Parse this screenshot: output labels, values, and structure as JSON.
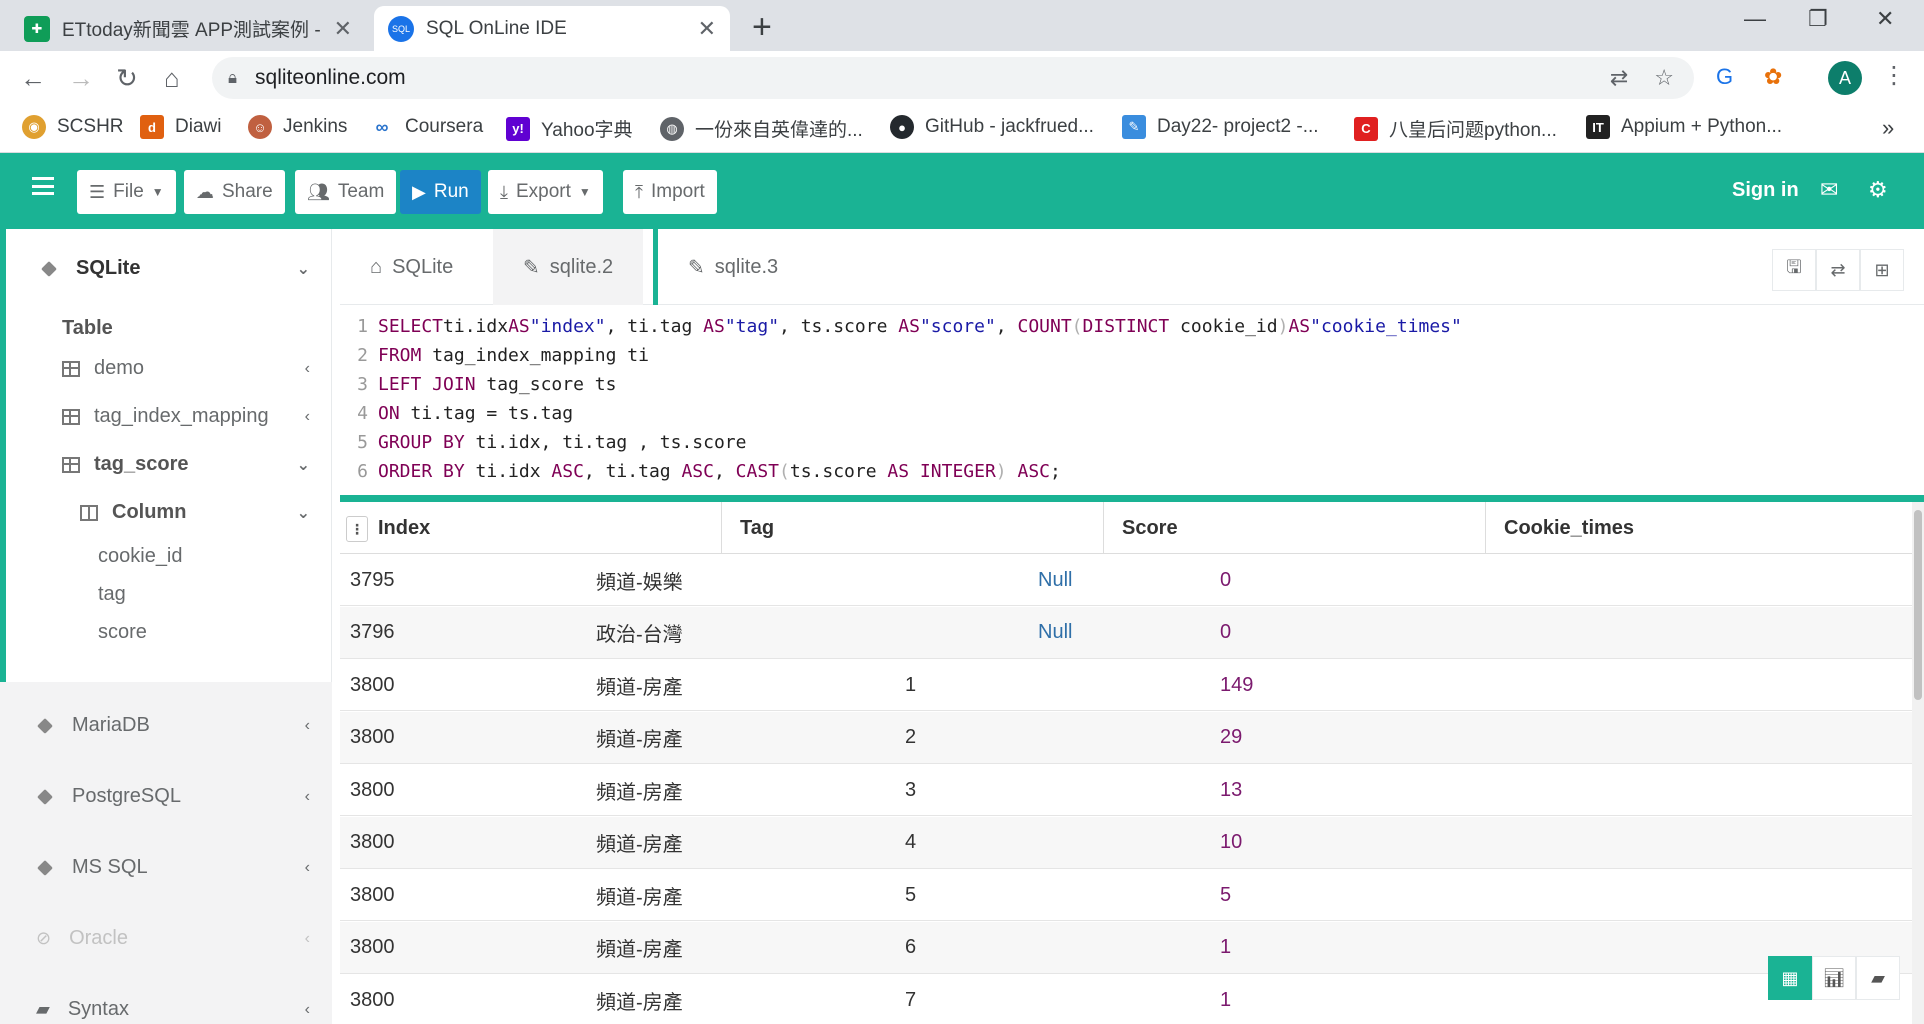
{
  "browser": {
    "tabs": [
      {
        "title": "ETtoday新聞雲 APP測試案例 - G",
        "icon": "sheets-icon",
        "active": false
      },
      {
        "title": "SQL OnLine IDE",
        "icon": "sql-icon",
        "active": true
      }
    ],
    "url": "sqliteonline.com",
    "profile_initial": "A",
    "bookmarks": [
      {
        "label": "SCSHR",
        "icon": "globe-icon",
        "color": "#e0a030"
      },
      {
        "label": "Diawi",
        "icon": "diawi-icon",
        "color": "#e06010"
      },
      {
        "label": "Jenkins",
        "icon": "jenkins-icon",
        "color": "#c06040"
      },
      {
        "label": "Coursera",
        "icon": "coursera-icon",
        "color": "#2a73cc"
      },
      {
        "label": "Yahoo字典",
        "icon": "yahoo-icon",
        "color": "#6001d2"
      },
      {
        "label": "一份來自英偉達的...",
        "icon": "globe-icon",
        "color": "#5f6368"
      },
      {
        "label": "GitHub - jackfrued...",
        "icon": "github-icon",
        "color": "#24292e"
      },
      {
        "label": "Day22- project2 -...",
        "icon": "ithome-icon",
        "color": "#3a8dde"
      },
      {
        "label": "八皇后问题python...",
        "icon": "csdn-icon",
        "color": "#e02020"
      },
      {
        "label": "Appium + Python...",
        "icon": "it-icon",
        "color": "#222222"
      }
    ]
  },
  "toolbar": {
    "file": "File",
    "share": "Share",
    "team": "Team",
    "run": "Run",
    "export": "Export",
    "import": "Import",
    "signin": "Sign in"
  },
  "sidebar": {
    "sqlite": "SQLite",
    "table_header": "Table",
    "tables": [
      "demo",
      "tag_index_mapping",
      "tag_score"
    ],
    "column_header": "Column",
    "columns": [
      "cookie_id",
      "tag",
      "score"
    ],
    "databases": [
      "MariaDB",
      "PostgreSQL",
      "MS SQL",
      "Oracle",
      "Syntax"
    ]
  },
  "editor": {
    "tabs": [
      "SQLite",
      "sqlite.2",
      "sqlite.3"
    ],
    "lines": [
      "SELECT ti.idx AS \"index\", ti.tag AS \"tag\", ts.score AS \"score\", COUNT(DISTINCT cookie_id) AS \"cookie_times\"",
      "FROM tag_index_mapping ti",
      "LEFT JOIN tag_score ts",
      "ON ti.tag = ts.tag",
      "GROUP BY ti.idx, ti.tag , ts.score",
      "ORDER BY ti.idx ASC, ti.tag ASC, CAST(ts.score AS INTEGER) ASC;"
    ]
  },
  "results": {
    "columns": [
      "Index",
      "Tag",
      "Score",
      "Cookie_times"
    ],
    "rows": [
      [
        "3795",
        "頻道-娛樂",
        "Null",
        "0"
      ],
      [
        "3796",
        "政治-台灣",
        "Null",
        "0"
      ],
      [
        "3800",
        "頻道-房產",
        "1",
        "149"
      ],
      [
        "3800",
        "頻道-房產",
        "2",
        "29"
      ],
      [
        "3800",
        "頻道-房產",
        "3",
        "13"
      ],
      [
        "3800",
        "頻道-房產",
        "4",
        "10"
      ],
      [
        "3800",
        "頻道-房產",
        "5",
        "5"
      ],
      [
        "3800",
        "頻道-房產",
        "6",
        "1"
      ],
      [
        "3800",
        "頻道-房產",
        "7",
        "1"
      ]
    ]
  },
  "colors": {
    "accent": "#1ab394",
    "run": "#1c84c6"
  }
}
